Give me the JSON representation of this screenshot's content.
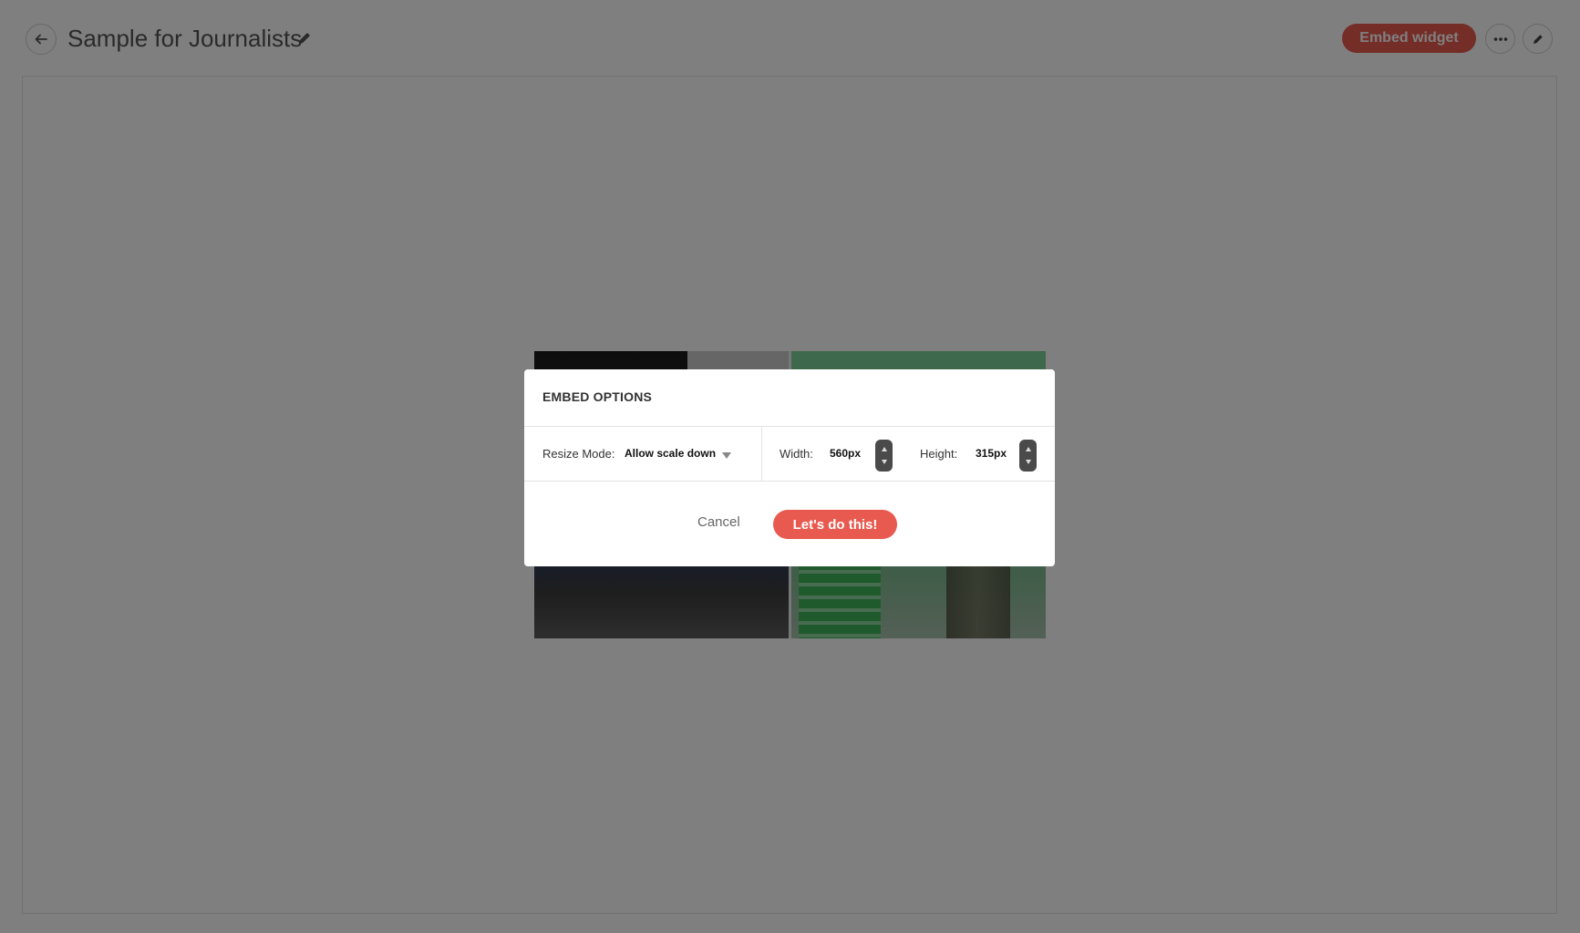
{
  "header": {
    "title": "Sample for Journalists",
    "embed_button": "Embed widget"
  },
  "icons": {
    "back": "back-arrow-icon",
    "title_edit": "pencil-icon",
    "more": "more-dots-icon",
    "edit": "pencil-icon"
  },
  "colors": {
    "accent": "#e85a4f",
    "overlay": "rgba(0,0,0,0.5)"
  },
  "modal": {
    "title": "EMBED OPTIONS",
    "resize_mode_label": "Resize Mode:",
    "resize_mode_value": "Allow scale down",
    "width_label": "Width:",
    "width_value": "560px",
    "height_label": "Height:",
    "height_value": "315px",
    "cancel_label": "Cancel",
    "confirm_label": "Let's do this!"
  }
}
